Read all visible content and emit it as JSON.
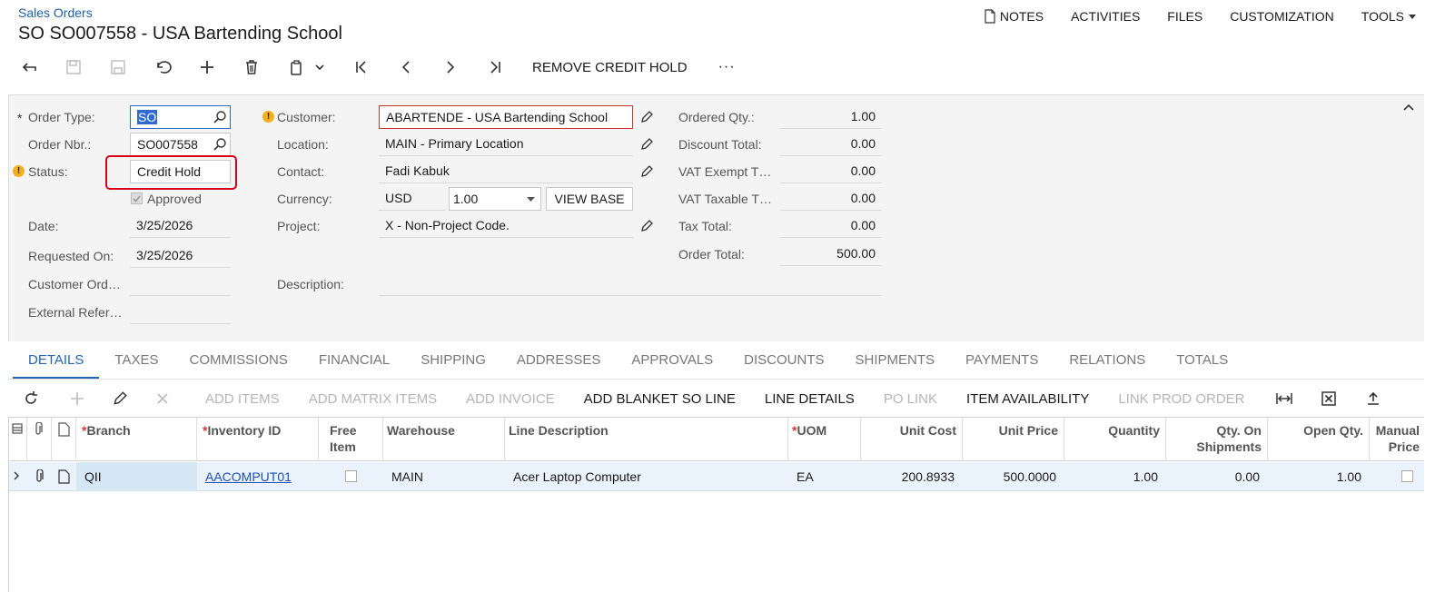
{
  "header": {
    "breadcrumb": "Sales Orders",
    "title": "SO SO007558 - USA Bartending School",
    "links": {
      "notes": "NOTES",
      "activities": "ACTIVITIES",
      "files": "FILES",
      "customization": "CUSTOMIZATION",
      "tools": "TOOLS"
    }
  },
  "toolbar": {
    "remove_credit_hold": "REMOVE CREDIT HOLD",
    "more": "···"
  },
  "form": {
    "order_type_label": "Order Type:",
    "order_type_value": "SO",
    "order_nbr_label": "Order Nbr.:",
    "order_nbr_value": "SO007558",
    "status_label": "Status:",
    "status_value": "Credit Hold",
    "approved_label": "Approved",
    "date_label": "Date:",
    "date_value": "3/25/2026",
    "requested_on_label": "Requested On:",
    "requested_on_value": "3/25/2026",
    "customer_ord_label": "Customer Ord…",
    "customer_ord_value": "",
    "external_ref_label": "External Refer…",
    "external_ref_value": "",
    "customer_label": "Customer:",
    "customer_value": "ABARTENDE - USA Bartending School",
    "location_label": "Location:",
    "location_value": "MAIN - Primary Location",
    "contact_label": "Contact:",
    "contact_value": "Fadi Kabuk",
    "currency_label": "Currency:",
    "currency_value": "USD",
    "rate_value": "1.00",
    "view_base": "VIEW BASE",
    "project_label": "Project:",
    "project_value": "X - Non-Project Code.",
    "description_label": "Description:",
    "description_value": "",
    "ordered_qty_label": "Ordered Qty.:",
    "ordered_qty_value": "1.00",
    "discount_total_label": "Discount Total:",
    "discount_total_value": "0.00",
    "vat_exempt_label": "VAT Exempt T…",
    "vat_exempt_value": "0.00",
    "vat_taxable_label": "VAT Taxable T…",
    "vat_taxable_value": "0.00",
    "tax_total_label": "Tax Total:",
    "tax_total_value": "0.00",
    "order_total_label": "Order Total:",
    "order_total_value": "500.00"
  },
  "tabs": [
    "DETAILS",
    "TAXES",
    "COMMISSIONS",
    "FINANCIAL",
    "SHIPPING",
    "ADDRESSES",
    "APPROVALS",
    "DISCOUNTS",
    "SHIPMENTS",
    "PAYMENTS",
    "RELATIONS",
    "TOTALS"
  ],
  "grid_toolbar": {
    "add_items": "ADD ITEMS",
    "add_matrix_items": "ADD MATRIX ITEMS",
    "add_invoice": "ADD INVOICE",
    "add_blanket": "ADD BLANKET SO LINE",
    "line_details": "LINE DETAILS",
    "po_link": "PO LINK",
    "item_availability": "ITEM AVAILABILITY",
    "link_prod_order": "LINK PROD ORDER"
  },
  "grid": {
    "columns": {
      "branch": "Branch",
      "inventory_id": "Inventory ID",
      "free_item_1": "Free",
      "free_item_2": "Item",
      "warehouse": "Warehouse",
      "line_description": "Line Description",
      "uom": "UOM",
      "unit_cost": "Unit Cost",
      "unit_price": "Unit Price",
      "quantity": "Quantity",
      "qty_on_shipments_1": "Qty. On",
      "qty_on_shipments_2": "Shipments",
      "open_qty": "Open Qty.",
      "manual_price_1": "Manual",
      "manual_price_2": "Price"
    },
    "rows": [
      {
        "branch": "QII",
        "inventory_id": "AACOMPUT01",
        "warehouse": "MAIN",
        "line_description": "Acer Laptop Computer",
        "uom": "EA",
        "unit_cost": "200.8933",
        "unit_price": "500.0000",
        "quantity": "1.00",
        "qty_on_shipments": "0.00",
        "open_qty": "1.00"
      }
    ]
  }
}
